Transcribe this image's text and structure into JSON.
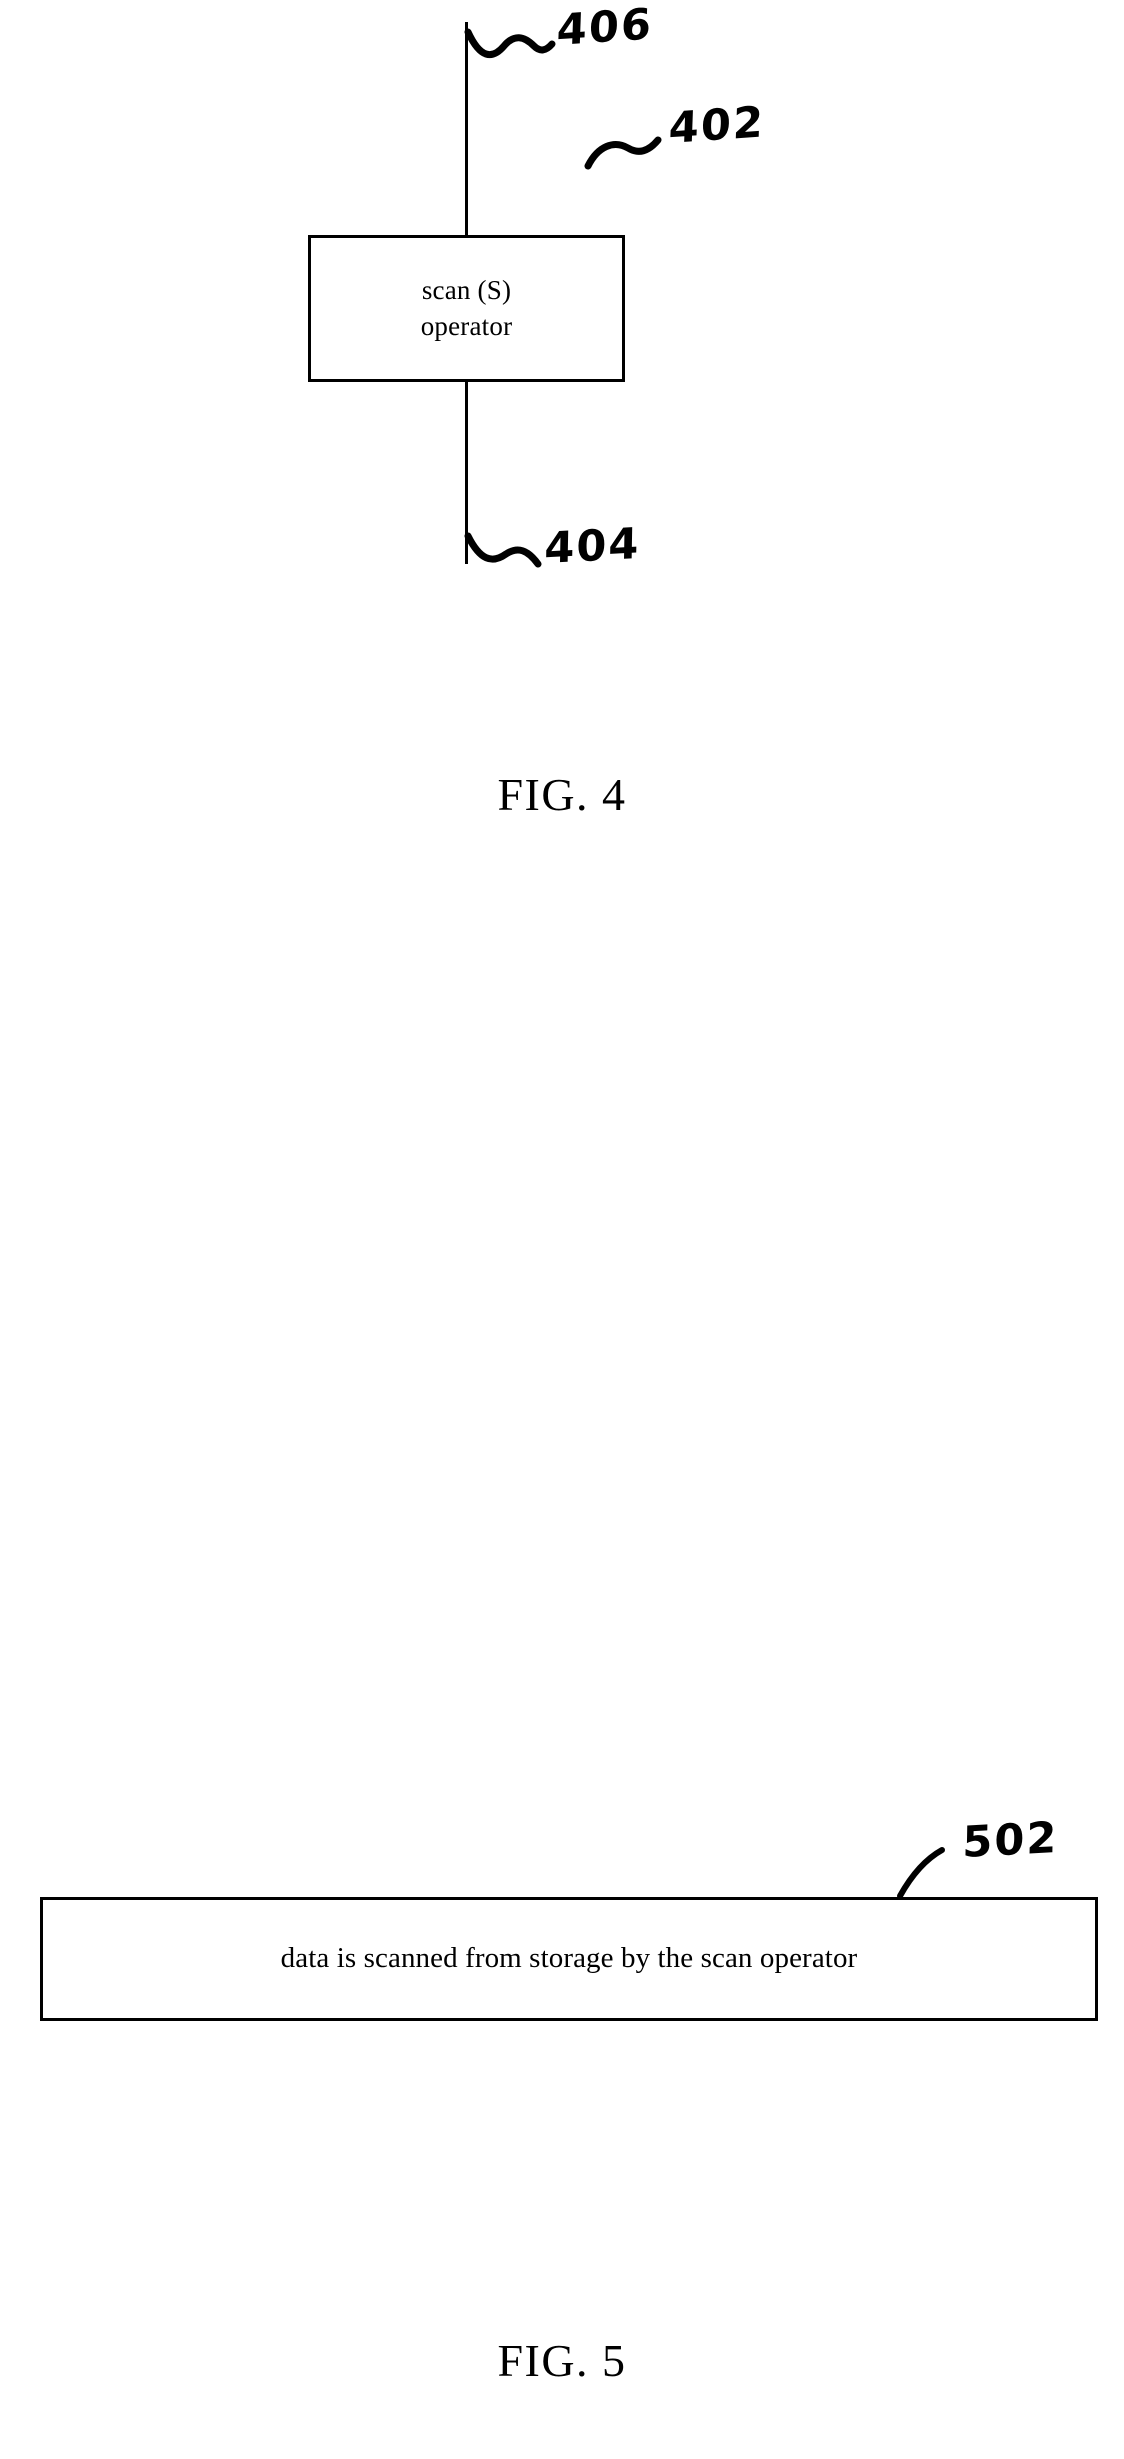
{
  "document": {
    "type": "patent-drawing-sheet",
    "background_color": "#ffffff",
    "ink_color": "#000000"
  },
  "figure4": {
    "caption": "FIG. 4",
    "operator_box": {
      "line1": "scan (S)",
      "line2": "operator",
      "ref_label": "402"
    },
    "input_edge": {
      "ref_label": "406"
    },
    "output_edge": {
      "ref_label": "404"
    }
  },
  "figure5": {
    "caption": "FIG. 5",
    "statement_box": {
      "text": "data is scanned from storage by the scan operator",
      "ref_label": "502"
    }
  }
}
